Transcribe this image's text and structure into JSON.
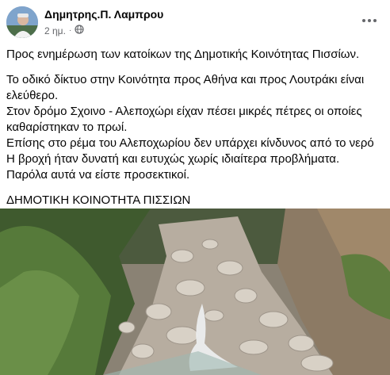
{
  "post": {
    "author": "Δημητρης.Π. Λαμπρου",
    "time": "2 ημ.",
    "separator": "·",
    "privacy_icon": "globe-icon",
    "more_icon": "more-horizontal-icon",
    "paragraphs": [
      "Προς ενημέρωση των κατοίκων της Δημοτικής Κοινότητας Πισσίων.",
      "Το οδικό δίκτυο στην Κοινότητα προς Αθήνα και προς Λουτράκι είναι ελεύθερο.",
      "Στον δρόμο Σχοινο -  Αλεποχώρι είχαν πέσει μικρές πέτρες οι οποίες καθαρίστηκαν το πρωί.",
      "Επίσης στο ρέμα του Αλεποχωρίου δεν υπάρχει κίνδυνος από το νερό",
      "Η βροχή ήταν δυνατή και ευτυχώς χωρίς ιδιαίτερα προβλήματα.",
      "Παρόλα αυτά να είστε προσεκτικοί.",
      "ΔΗΜΟΤΙΚΗ ΚΟΙΝΟΤΗΤΑ ΠΙΣΣΙΩΝ"
    ]
  },
  "colors": {
    "text": "#050505",
    "secondary": "#65676b",
    "background": "#ffffff"
  }
}
